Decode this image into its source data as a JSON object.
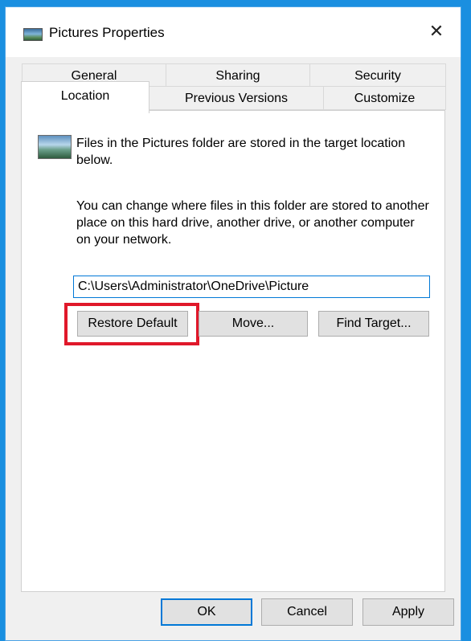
{
  "window": {
    "title": "Pictures Properties",
    "close_glyph": "✕"
  },
  "tabs": {
    "row1": [
      "General",
      "Sharing",
      "Security"
    ],
    "row2": [
      "Location",
      "Previous Versions",
      "Customize"
    ],
    "active": "Location"
  },
  "location": {
    "info_text": "Files in the Pictures folder are stored in the target location below.",
    "change_text": "You can change where files in this folder are stored to another place on this hard drive, another drive, or another computer on your network.",
    "path_value": "C:\\Users\\Administrator\\OneDrive\\Picture",
    "restore_default_label": "Restore Default",
    "move_label": "Move...",
    "find_target_label": "Find Target..."
  },
  "footer": {
    "ok_label": "OK",
    "cancel_label": "Cancel",
    "apply_label": "Apply"
  },
  "colors": {
    "desktop": "#1a8fe0",
    "highlight": "#e0182a",
    "focus_accent": "#0078d7"
  },
  "icons": {
    "title_icon": "pictures-folder-icon",
    "folder_icon": "pictures-folder-icon"
  }
}
